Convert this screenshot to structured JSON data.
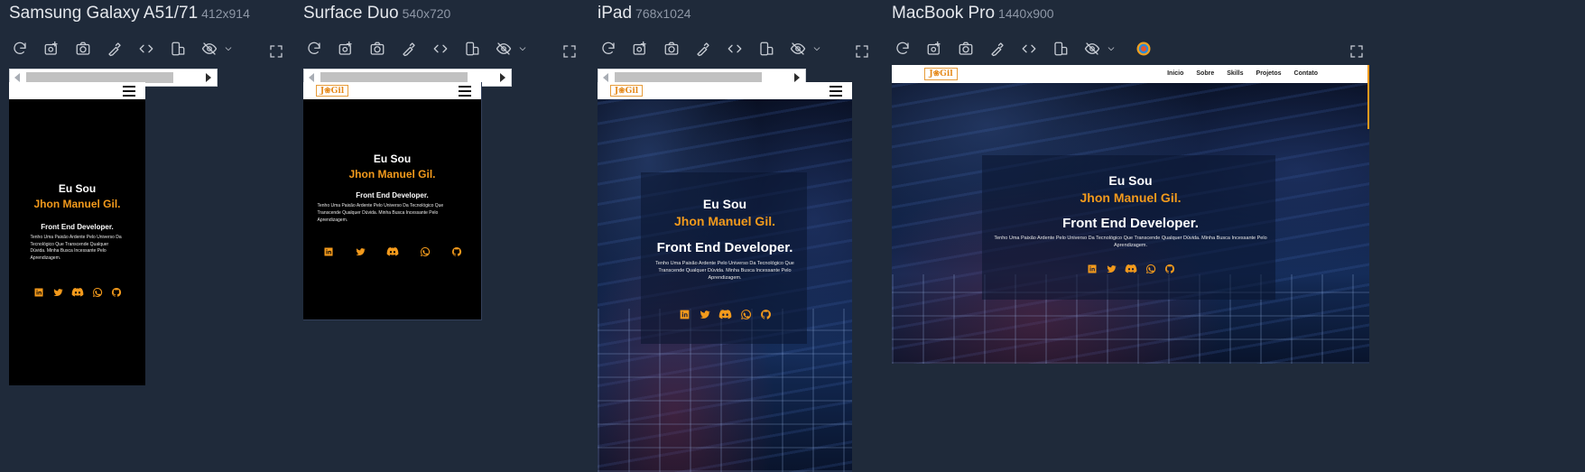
{
  "devices": [
    {
      "name": "Samsung Galaxy A51/71",
      "size": "412x914"
    },
    {
      "name": "Surface Duo",
      "size": "540x720"
    },
    {
      "name": "iPad",
      "size": "768x1024"
    },
    {
      "name": "MacBook Pro",
      "size": "1440x900"
    }
  ],
  "site": {
    "logo": "J❀Gil",
    "nav": [
      "Inicio",
      "Sobre",
      "Skills",
      "Projetos",
      "Contato"
    ],
    "greeting": "Eu Sou",
    "name": "Jhon Manuel Gil.",
    "role": "Front End Developer.",
    "description": "Tenho Uma Paixão Ardente Pelo Universo Da Tecnológico Que Transcende Qualquer Dúvida. Minha Busca Incessante Pelo Aprendizagem."
  },
  "icons": {
    "toolbar": [
      "refresh-icon",
      "screenshot-full-icon",
      "camera-icon",
      "eyedropper-icon",
      "code-icon",
      "rotate-icon",
      "eye-off-icon",
      "chevron-down-icon"
    ],
    "socials": [
      "linkedin-icon",
      "twitter-icon",
      "discord-icon",
      "whatsapp-icon",
      "github-icon"
    ]
  },
  "colors": {
    "background": "#1f2a3a",
    "accent": "#f39a1c"
  }
}
